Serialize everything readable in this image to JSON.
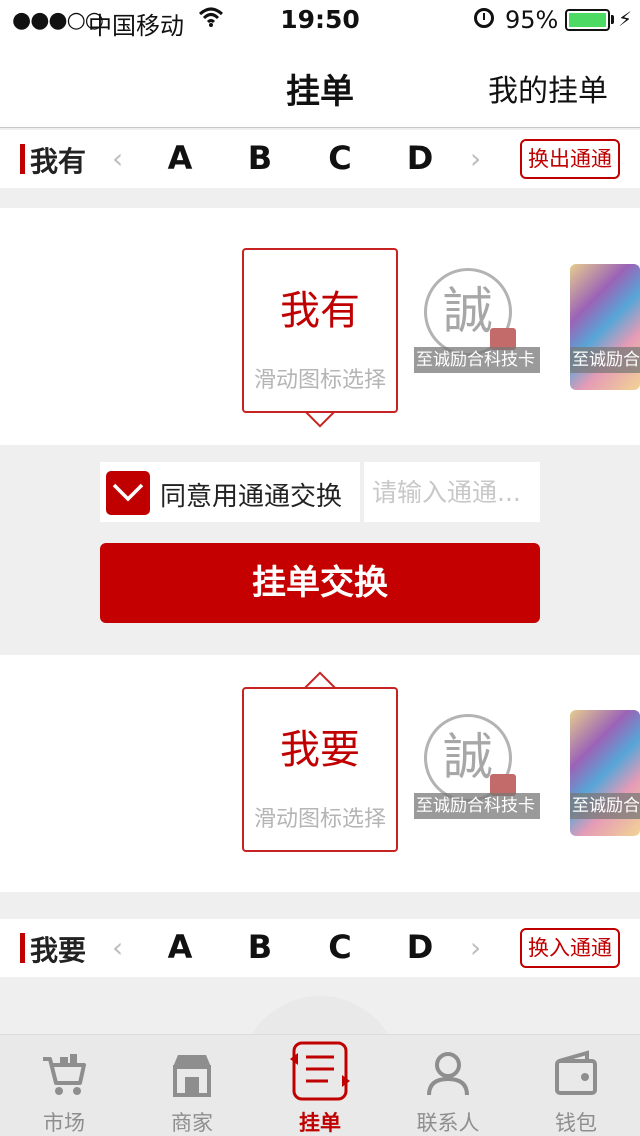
{
  "status_bar": {
    "signal": "●●●○○",
    "carrier": "中国移动",
    "time": "19:50",
    "battery": "95%",
    "battery_level": 0.95
  },
  "nav": {
    "title": "挂单",
    "right_action": "我的挂单"
  },
  "have_selector": {
    "label": "我有",
    "prev": "‹",
    "next": "›",
    "letters": [
      "A",
      "B",
      "C",
      "D"
    ],
    "channel_button": "换出通通"
  },
  "have_panel": {
    "title": "我有",
    "hint": "滑动图标选择",
    "seal_char": "誠",
    "thumb_caption": "至诚励合科技卡",
    "art_caption": "至诚励合"
  },
  "agree": {
    "label": "同意用通通交换",
    "checked": true,
    "input_placeholder": "请输入通通..."
  },
  "submit": {
    "label": "挂单交换"
  },
  "want_panel": {
    "title": "我要",
    "hint": "滑动图标选择",
    "seal_char": "誠",
    "thumb_caption": "至诚励合科技卡",
    "art_caption": "至诚励合"
  },
  "want_selector": {
    "label": "我要",
    "prev": "‹",
    "next": "›",
    "letters": [
      "A",
      "B",
      "C",
      "D"
    ],
    "channel_button": "换入通通"
  },
  "tabbar": {
    "items": [
      {
        "label": "市场",
        "icon": "cart-icon"
      },
      {
        "label": "商家",
        "icon": "store-icon"
      },
      {
        "label": "挂单",
        "icon": "order-exchange-icon",
        "active": true
      },
      {
        "label": "联系人",
        "icon": "contact-icon"
      },
      {
        "label": "钱包",
        "icon": "wallet-icon"
      }
    ]
  },
  "colors": {
    "accent": "#c00000",
    "hint": "#b5b5b5",
    "background": "#efefef"
  }
}
